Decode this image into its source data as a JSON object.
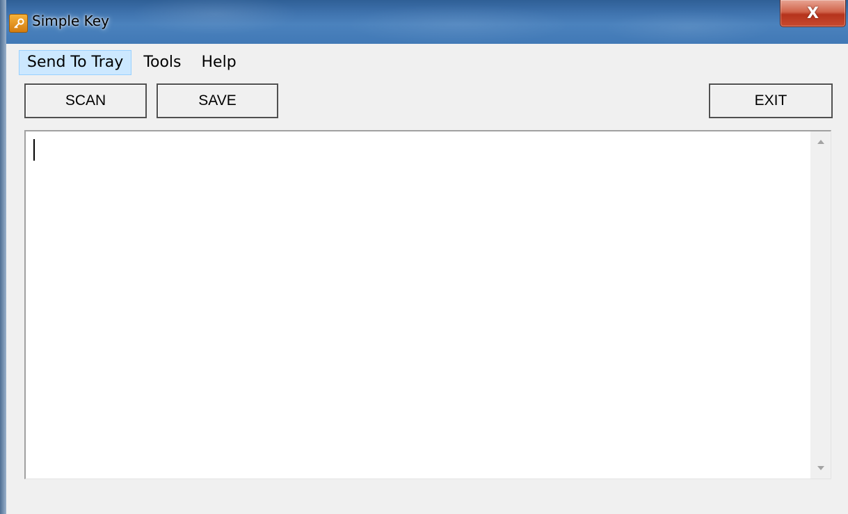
{
  "window": {
    "title": "Simple Key",
    "close_label": "X",
    "icon": "key-icon"
  },
  "menu": [
    {
      "label": "Send To Tray",
      "active": true
    },
    {
      "label": "Tools",
      "active": false
    },
    {
      "label": "Help",
      "active": false
    }
  ],
  "toolbar": {
    "scan_label": "SCAN",
    "save_label": "SAVE",
    "exit_label": "EXIT"
  },
  "editor": {
    "value": ""
  },
  "colors": {
    "titlebar": "#4179b6",
    "close": "#c84a2f",
    "menu_highlight": "#cce8ff",
    "client_bg": "#f0f0f0"
  }
}
